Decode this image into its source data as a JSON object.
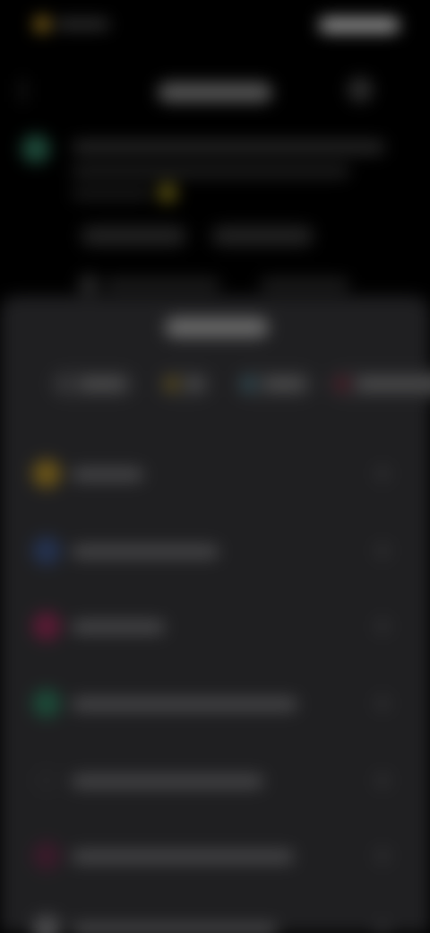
{
  "screen": {
    "title": "",
    "sheet_title": ""
  },
  "status_bar": {
    "time": ""
  },
  "chips": [
    {
      "label": "",
      "color": "#3a3a3c"
    },
    {
      "label": "",
      "color": "#5a4a14"
    },
    {
      "label": "",
      "color": "#2a4a54"
    },
    {
      "label": "",
      "color": "#4a1420"
    }
  ],
  "options": [
    {
      "label": "",
      "icon": "star-icon",
      "color": "#6a5418"
    },
    {
      "label": "",
      "icon": "bookmark-icon",
      "color": "#243250"
    },
    {
      "label": "",
      "icon": "heart-icon",
      "color": "#5a1a34"
    },
    {
      "label": "",
      "icon": "link-icon",
      "color": "#1c4a38"
    },
    {
      "label": "",
      "icon": "share-icon",
      "color": "#222224"
    },
    {
      "label": "",
      "icon": "flag-icon",
      "color": "#3a1a2a"
    },
    {
      "label": "",
      "icon": "info-icon",
      "color": "#4a4a4c"
    }
  ],
  "colors": {
    "background": "#000000",
    "sheet": "#1f1f21",
    "accent_yellow": "#8a6a1c",
    "accent_green": "#1e4a3a"
  }
}
